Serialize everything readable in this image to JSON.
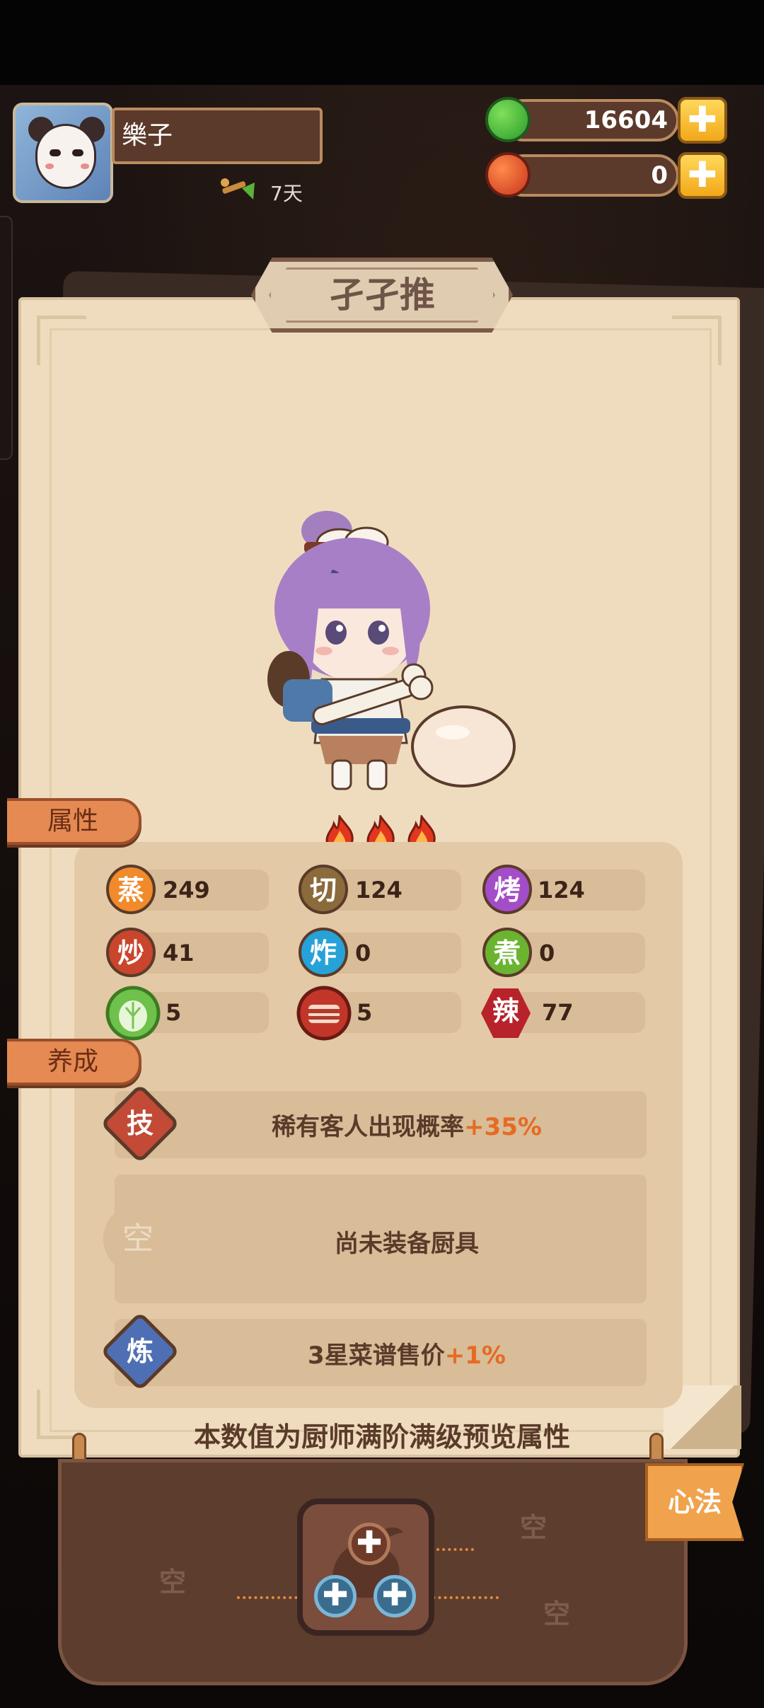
{
  "player": {
    "name": "樂子",
    "days": "7天"
  },
  "currency": {
    "green_value": "16604",
    "red_value": "0",
    "plus_label": "✚",
    "green_icon": "green-apple-icon",
    "red_icon": "red-apple-icon"
  },
  "chef": {
    "title": "孑孑推",
    "stars": 3
  },
  "tags": {
    "attributes": "属性",
    "training": "养成"
  },
  "stats": [
    {
      "icon_char": "蒸",
      "value": "249",
      "color": "#f08a2a"
    },
    {
      "icon_char": "切",
      "value": "124",
      "color": "#8b6a3c"
    },
    {
      "icon_char": "烤",
      "value": "124",
      "color": "#a44dc8"
    },
    {
      "icon_char": "炒",
      "value": "41",
      "color": "#c9452c"
    },
    {
      "icon_char": "炸",
      "value": "0",
      "color": "#27a2d8"
    },
    {
      "icon_char": "煮",
      "value": "0",
      "color": "#6bb42f"
    },
    {
      "icon_char": "",
      "value": "5",
      "color": "#6ec14a",
      "icon": "cabbage-icon"
    },
    {
      "icon_char": "",
      "value": "5",
      "color": "#c2362a",
      "icon": "meat-icon"
    },
    {
      "icon_char": "辣",
      "value": "77",
      "color": "#b8222a",
      "icon": "spicy-icon"
    }
  ],
  "training": {
    "skill_badge": "技",
    "skill_text": "稀有客人出现概率",
    "skill_bonus": "+35%",
    "equip_badge": "空",
    "equip_text": "尚未装备厨具",
    "refine_badge": "炼",
    "refine_text": "3星菜谱售价",
    "refine_bonus": "+1%"
  },
  "footer_note": "本数值为厨师满阶满级预览属性",
  "bottom": {
    "xinfa": "心法",
    "slot_empty": "空",
    "plus": "✚"
  }
}
